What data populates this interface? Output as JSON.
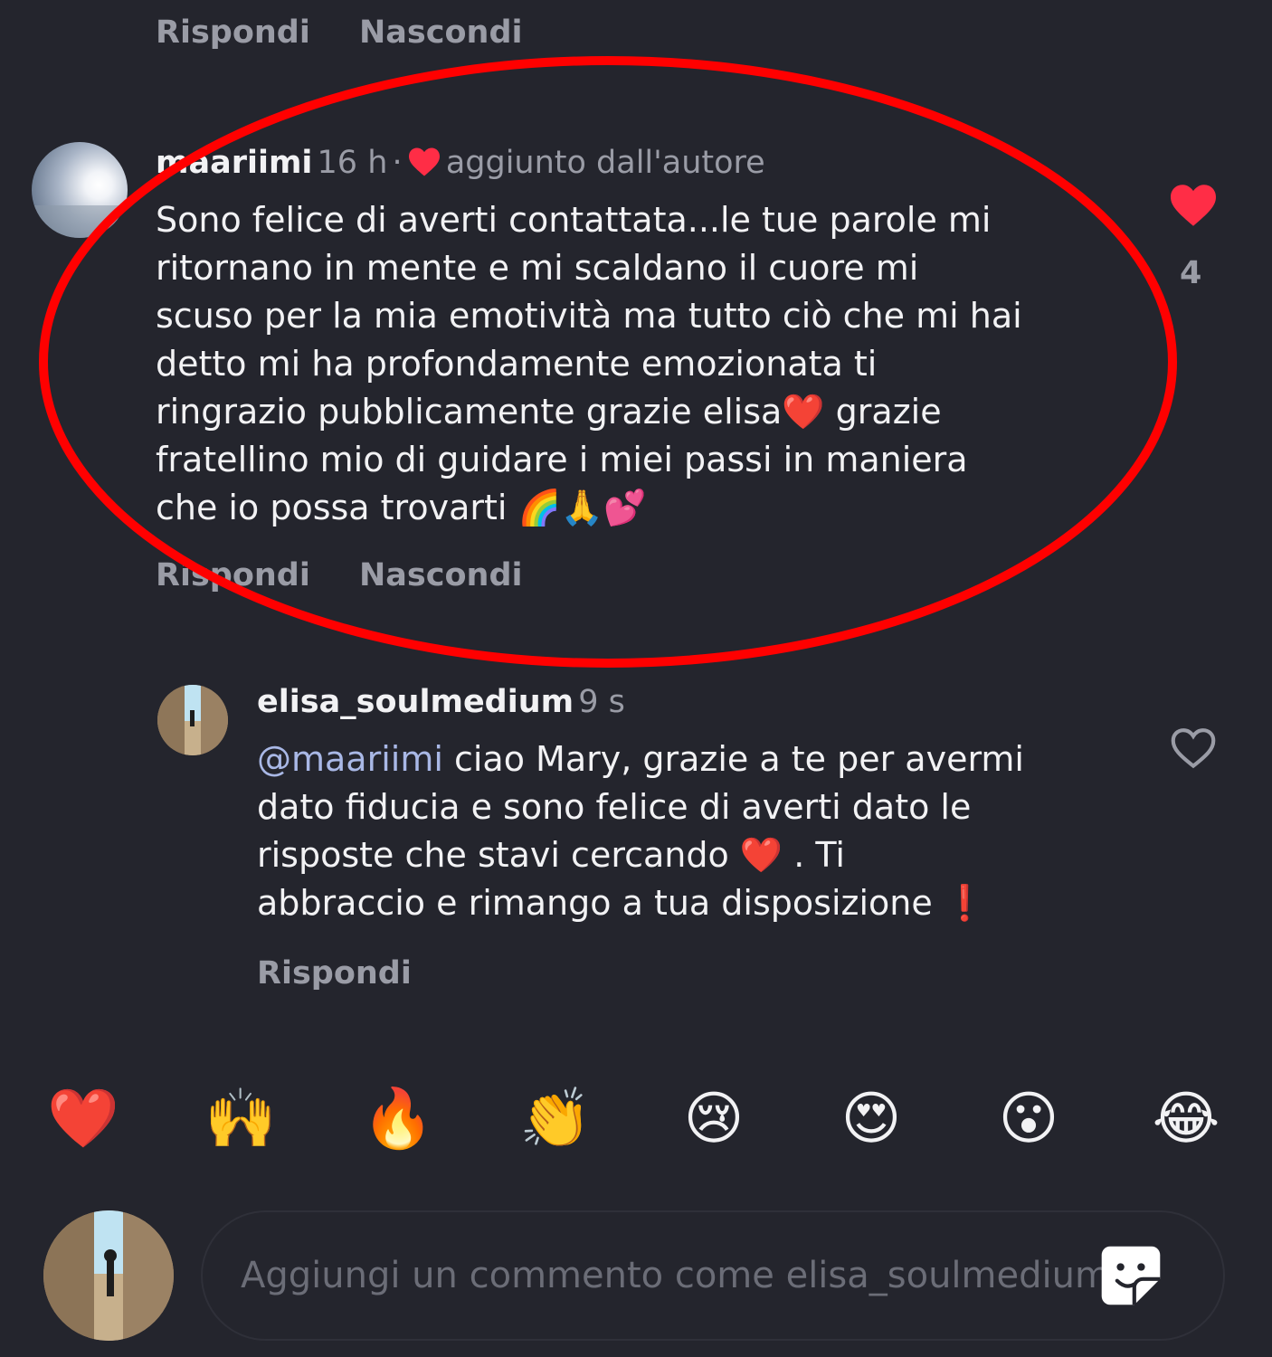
{
  "top_actions": {
    "reply": "Rispondi",
    "hide": "Nascondi"
  },
  "comment": {
    "username": "maariimi",
    "time": "16 h",
    "separator": "·",
    "author_like_label": "aggiunto dall'autore",
    "text": "Sono felice di averti contattata...le tue parole mi\nritornano in mente e mi scaldano il cuore mi\nscuso per la mia emotività ma tutto ciò che mi hai\ndetto mi ha profondamente emozionata ti\nringrazio pubblicamente grazie elisa❤️ grazie\nfratellino mio di guidare i miei passi in maniera\nche io possa trovarti 🌈🙏💕",
    "like_count": "4",
    "reply_label": "Rispondi",
    "hide_label": "Nascondi"
  },
  "reply": {
    "username": "elisa_soulmedium",
    "time": "9 s",
    "mention": "@maariimi",
    "text": " ciao Mary, grazie a te per avermi\ndato fiducia e sono felice di averti dato le\nrisposte che stavi cercando ❤️ . Ti\nabbraccio e rimango a tua disposizione ❗️",
    "reply_label": "Rispondi"
  },
  "quick_reactions": [
    "❤️",
    "🙌",
    "🔥",
    "👏",
    "😢",
    "😍",
    "😮",
    "😂"
  ],
  "composer": {
    "placeholder": "Aggiungi un commento come elisa_soulmedium"
  },
  "colors": {
    "background": "#24252d",
    "heart": "#ff2d46",
    "annotation": "#ff0000",
    "muted": "#9a9ca6"
  },
  "icons": {
    "liked": "heart-filled-icon",
    "unliked": "heart-outline-icon",
    "sticker": "sticker-icon"
  }
}
